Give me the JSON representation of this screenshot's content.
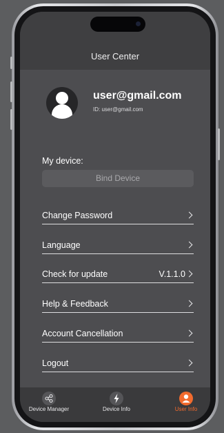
{
  "header": {
    "title": "User Center"
  },
  "profile": {
    "email": "user@gmail.com",
    "id_text": "ID: user@gmail.com"
  },
  "device": {
    "heading": "My device:",
    "bind_label": "Bind Device"
  },
  "menu": [
    {
      "label": "Change Password",
      "value": ""
    },
    {
      "label": "Language",
      "value": ""
    },
    {
      "label": "Check for update",
      "value": "V.1.1.0"
    },
    {
      "label": "Help & Feedback",
      "value": ""
    },
    {
      "label": "Account Cancellation",
      "value": ""
    },
    {
      "label": "Logout",
      "value": ""
    }
  ],
  "tabs": [
    {
      "label": "Device Manager",
      "icon": "share-nodes-icon",
      "active": false
    },
    {
      "label": "Device Info",
      "icon": "lightning-icon",
      "active": false
    },
    {
      "label": "User Info",
      "icon": "user-icon",
      "active": true
    }
  ],
  "colors": {
    "accent": "#f26b2e",
    "background": "#4d4d50",
    "header": "#3f3f41",
    "tabbar": "#3a3a3c"
  }
}
